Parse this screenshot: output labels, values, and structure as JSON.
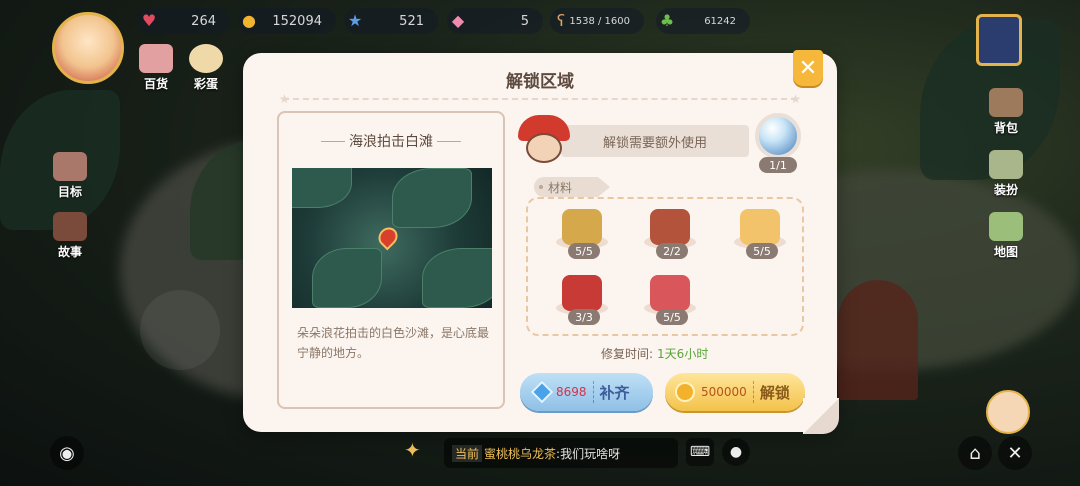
{
  "hud": {
    "hearts": "264",
    "coins": "152094",
    "stars": "521",
    "gems": "5",
    "bear": "1538 / 1600",
    "clover": "61242"
  },
  "side_left": {
    "shop": "百货",
    "egg": "彩蛋",
    "goal": "目标",
    "story": "故事"
  },
  "side_right": {
    "bag": "背包",
    "dress": "装扮",
    "map": "地图"
  },
  "modal": {
    "title": "解锁区域",
    "close_glyph": "✕",
    "card": {
      "title": "海浪拍击白滩",
      "description": "朵朵浪花拍击的白色沙滩，是心底最宁静的地方。"
    },
    "requirement_text": "解锁需要额外使用",
    "orb_count": "1/1",
    "materials_tag": "材料",
    "materials": [
      {
        "icon": "lamp-icon",
        "count": "5/5",
        "color": "#d6a84c"
      },
      {
        "icon": "cake-stand-icon",
        "count": "2/2",
        "color": "#b4533b"
      },
      {
        "icon": "bottle-icon",
        "count": "5/5",
        "color": "#f2c36a"
      },
      {
        "icon": "red-chair-icon",
        "count": "3/3",
        "color": "#c73a35"
      },
      {
        "icon": "meat-plate-icon",
        "count": "5/5",
        "color": "#d9565a"
      }
    ],
    "repair_label": "修复时间:",
    "repair_time": "1天6小时",
    "fill_button": {
      "cost": "8698",
      "label": "补齐"
    },
    "unlock_button": {
      "cost": "500000",
      "label": "解锁"
    }
  },
  "chat": {
    "channel": "当前",
    "sender": "蜜桃桃乌龙茶",
    "message": ":我们玩啥呀"
  }
}
